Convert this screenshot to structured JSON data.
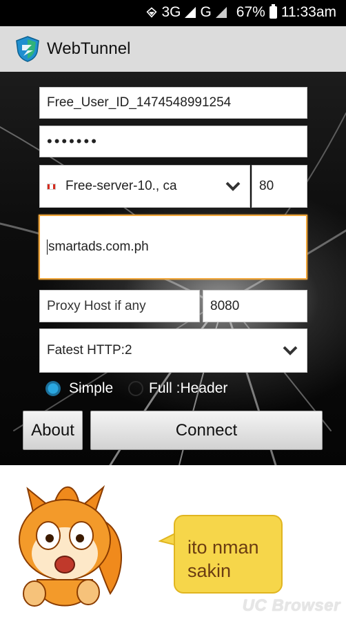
{
  "status_bar": {
    "network_3g": "3G",
    "network_g": "G",
    "battery": "67%",
    "time": "11:33am"
  },
  "app": {
    "title": "WebTunnel",
    "logo_icon": "webtunnel-shield-logo-icon"
  },
  "form": {
    "user_id": "Free_User_ID_1474548991254",
    "password_mask": "•••••••",
    "server": {
      "label": "Free-server-10., ca",
      "flag_icon": "canada-flag-icon",
      "port": "80"
    },
    "host": "smartads.com.ph",
    "proxy_host_placeholder": "Proxy Host if any",
    "proxy_port": "8080",
    "mode_select": "Fatest HTTP:2",
    "radio_options": [
      {
        "label": "Simple",
        "selected": true
      },
      {
        "label": "Full :Header",
        "selected": false
      }
    ]
  },
  "buttons": {
    "about": "About",
    "connect": "Connect"
  },
  "sticker": {
    "bubble_text_line1": "ito nman",
    "bubble_text_line2": "sakin",
    "character_icon": "uc-squirrel-mascot-icon",
    "bubble_color": "#f6d64a"
  },
  "watermark": "UC Browser",
  "colors": {
    "focus_border": "#f0a63a",
    "radio_selected": "#2aa7e0",
    "app_bar": "#dcdcdc"
  }
}
